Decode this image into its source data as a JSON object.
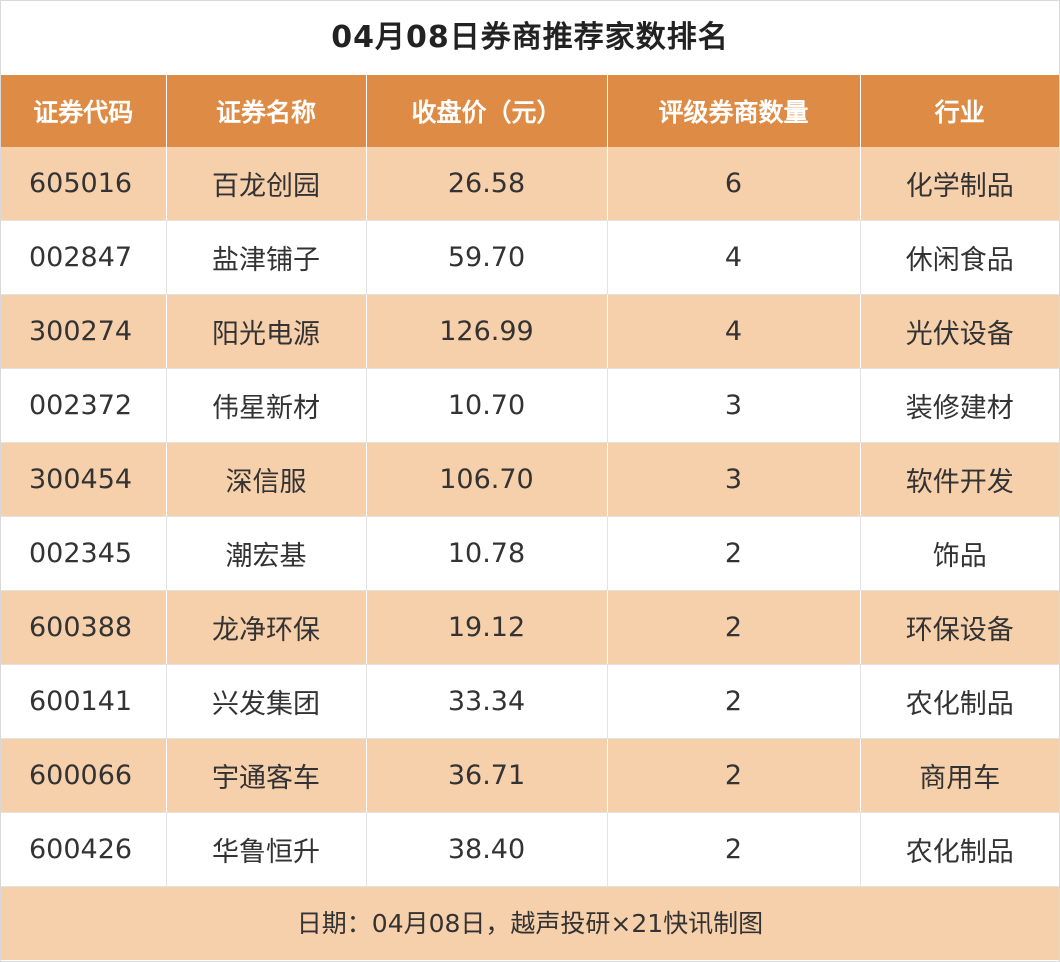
{
  "chart_data": {
    "type": "table",
    "title": "04月08日券商推荐家数排名",
    "columns": [
      "证券代码",
      "证券名称",
      "收盘价（元）",
      "评级券商数量",
      "行业"
    ],
    "rows": [
      [
        "605016",
        "百龙创园",
        "26.58",
        "6",
        "化学制品"
      ],
      [
        "002847",
        "盐津铺子",
        "59.70",
        "4",
        "休闲食品"
      ],
      [
        "300274",
        "阳光电源",
        "126.99",
        "4",
        "光伏设备"
      ],
      [
        "002372",
        "伟星新材",
        "10.70",
        "3",
        "装修建材"
      ],
      [
        "300454",
        "深信服",
        "106.70",
        "3",
        "软件开发"
      ],
      [
        "002345",
        "潮宏基",
        "10.78",
        "2",
        "饰品"
      ],
      [
        "600388",
        "龙净环保",
        "19.12",
        "2",
        "环保设备"
      ],
      [
        "600141",
        "兴发集团",
        "33.34",
        "2",
        "农化制品"
      ],
      [
        "600066",
        "宇通客车",
        "36.71",
        "2",
        "商用车"
      ],
      [
        "600426",
        "华鲁恒升",
        "38.40",
        "2",
        "农化制品"
      ]
    ],
    "footer": "日期：04月08日，越声投研×21快讯制图"
  },
  "colors": {
    "header_bg": "#de8b45",
    "stripe_bg": "#f6cfab",
    "white": "#ffffff"
  }
}
